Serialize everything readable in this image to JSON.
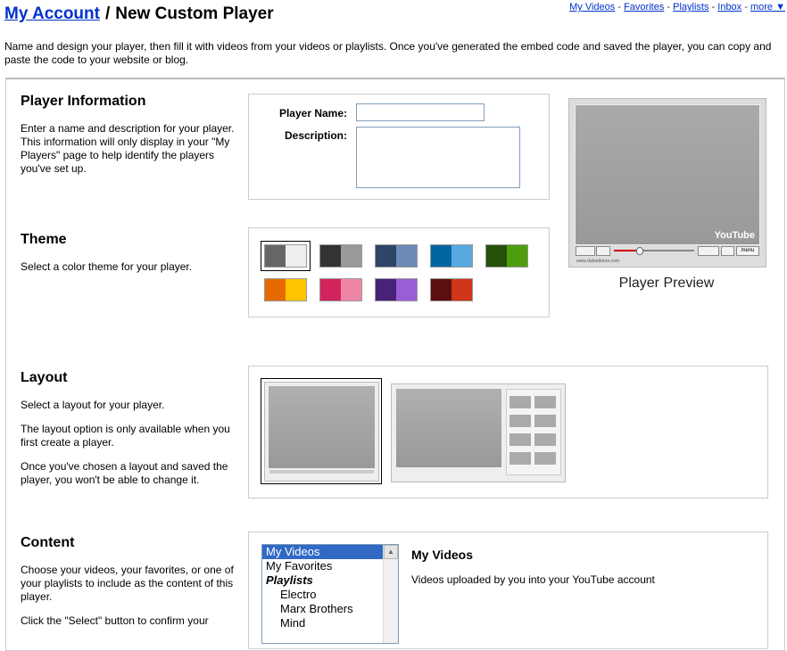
{
  "header": {
    "account_link": "My Account",
    "separator": "/",
    "page_title": "New Custom Player"
  },
  "topnav": {
    "items": [
      "My Videos",
      "Favorites",
      "Playlists",
      "Inbox",
      "more ▼"
    ],
    "separator": "-"
  },
  "intro": "Name and design your player, then fill it with videos from your videos or playlists. Once you've generated the embed code and saved the player, you can copy and paste the code to your website or blog.",
  "player_info": {
    "heading": "Player Information",
    "description": "Enter a name and description for your player. This information will only display in your \"My Players\" page to help identify the players you've set up.",
    "name_label": "Player Name:",
    "name_value": "",
    "description_label": "Description:",
    "description_value": ""
  },
  "theme": {
    "heading": "Theme",
    "description": "Select a color theme for your player.",
    "swatches": [
      {
        "left": "#666666",
        "right": "#eeeeee",
        "selected": true
      },
      {
        "left": "#333333",
        "right": "#999999",
        "selected": false
      },
      {
        "left": "#2e4566",
        "right": "#6e8ab6",
        "selected": false
      },
      {
        "left": "#0066a1",
        "right": "#59a9e0",
        "selected": false
      },
      {
        "left": "#24500a",
        "right": "#4f9e0f",
        "selected": false
      },
      {
        "left": "#e66a00",
        "right": "#ffc300",
        "selected": false
      },
      {
        "left": "#d2245c",
        "right": "#f086a6",
        "selected": false
      },
      {
        "left": "#472277",
        "right": "#9a5dd6",
        "selected": false
      },
      {
        "left": "#5c0f0f",
        "right": "#d0361a",
        "selected": false
      }
    ]
  },
  "preview": {
    "label": "Player Preview",
    "logo": "YouTube",
    "menu": "menu",
    "url": "www.dubadirture.com"
  },
  "layout": {
    "heading": "Layout",
    "p1": "Select a layout for your player.",
    "p2": "The layout option is only available when you first create a player.",
    "p3": "Once you've chosen a layout and saved the player, you won't be able to change it."
  },
  "content": {
    "heading": "Content",
    "p1": "Choose your videos, your favorites, or one of your playlists to include as the content of this player.",
    "p2": "Click the \"Select\" button to confirm your",
    "list": [
      {
        "label": "My Videos",
        "kind": "sel"
      },
      {
        "label": "My Favorites",
        "kind": "item"
      },
      {
        "label": "Playlists",
        "kind": "grp"
      },
      {
        "label": "Electro",
        "kind": "sub"
      },
      {
        "label": "Marx Brothers",
        "kind": "sub"
      },
      {
        "label": "Mind",
        "kind": "sub"
      }
    ],
    "detail_title": "My Videos",
    "detail_text": "Videos uploaded by you into your YouTube account"
  }
}
